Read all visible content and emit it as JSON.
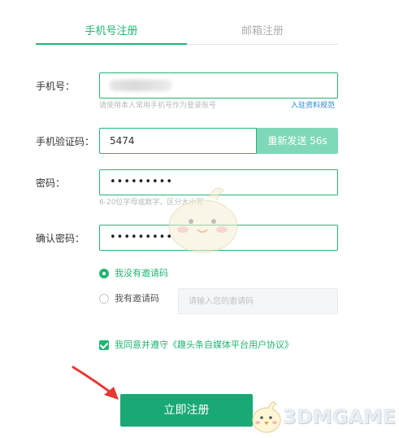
{
  "tabs": [
    {
      "label": "手机号注册",
      "active": true
    },
    {
      "label": "邮箱注册",
      "active": false
    }
  ],
  "form": {
    "phone": {
      "label": "手机号：",
      "hint": "请使用本人常用手机号作为登录账号",
      "link": "入驻资料规范"
    },
    "code": {
      "label": "手机验证码：",
      "value": "5474",
      "resend": "重新发送 56s"
    },
    "password": {
      "label": "密码：",
      "dots": "•••••••••",
      "hint": "6-20位字母或数字，区分大小写"
    },
    "confirm": {
      "label": "确认密码：",
      "dots": "•••••••••"
    },
    "invite": {
      "option_none": "我没有邀请码",
      "option_have": "我有邀请码",
      "placeholder": "请输入您的邀请码",
      "selected": "none"
    },
    "agreement": {
      "text": "我同意并遵守《趣头条自媒体平台用户协议》",
      "checked": true
    },
    "submit": "立即注册"
  },
  "watermark": {
    "text": "3DMGAME"
  },
  "colors": {
    "accent": "#22b573",
    "button": "#19a974",
    "resend_bg": "#7fd9b8",
    "link": "#2a86d6",
    "arrow": "#e53935"
  }
}
